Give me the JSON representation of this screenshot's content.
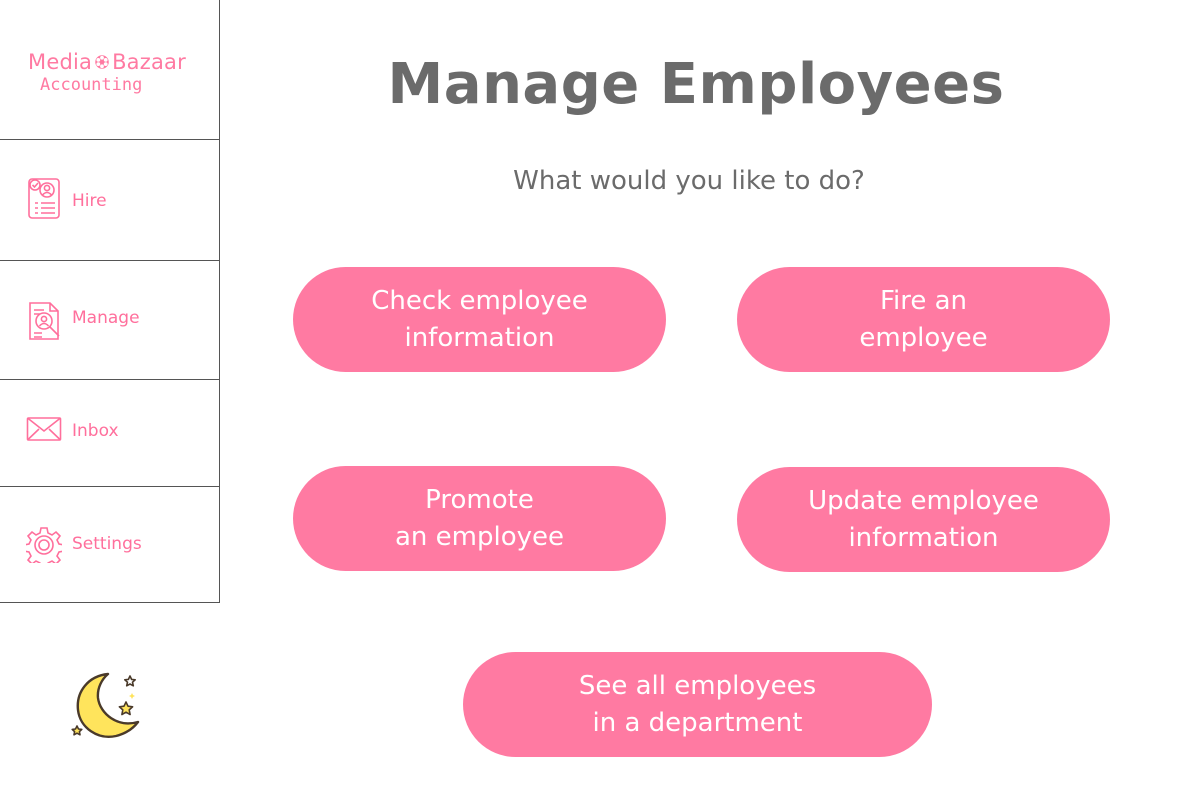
{
  "app": {
    "logo_line1_a": "Media",
    "logo_line1_b": "Bazaar",
    "logo_line2": "Accounting",
    "logo_icon": "gear-icon",
    "brand_color": "#ff7aa2",
    "text_color": "#6b6b6b"
  },
  "sidebar": {
    "items": [
      {
        "label": "Hire",
        "icon": "resume-icon"
      },
      {
        "label": "Manage",
        "icon": "document-search-icon"
      },
      {
        "label": "Inbox",
        "icon": "envelope-icon"
      },
      {
        "label": "Settings",
        "icon": "gear-icon"
      }
    ],
    "theme_toggle_icon": "moon-stars-icon"
  },
  "main": {
    "title": "Manage Employees",
    "subtitle": "What would you like to do?",
    "actions": [
      {
        "label": "Check employee\ninformation"
      },
      {
        "label": "Fire an\nemployee"
      },
      {
        "label": "Promote\nan employee"
      },
      {
        "label": "Update employee\ninformation"
      },
      {
        "label": "See all employees\nin a department"
      }
    ]
  }
}
